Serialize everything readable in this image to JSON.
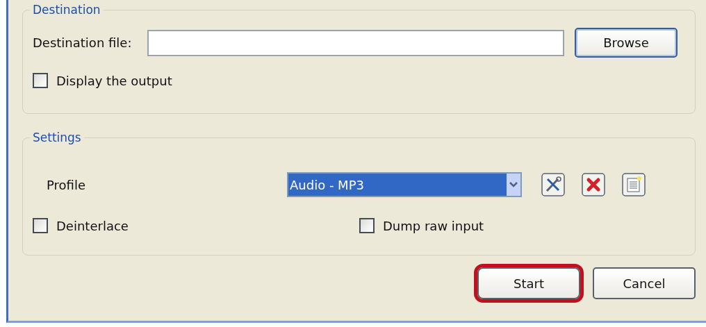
{
  "destination": {
    "title": "Destination",
    "file_label": "Destination file:",
    "browse": "Browse",
    "display_output": {
      "label": "Display the output",
      "checked": false
    }
  },
  "settings": {
    "title": "Settings",
    "profile_label": "Profile",
    "profile": {
      "value": "Audio - MP3",
      "focused": true
    },
    "tool_buttons": [
      {
        "kind": "edit"
      },
      {
        "kind": "delete"
      },
      {
        "kind": "new"
      }
    ],
    "options": [
      {
        "label": "Deinterlace",
        "checked": false
      },
      {
        "label": "Dump raw input",
        "checked": false
      }
    ]
  },
  "buttons": [
    {
      "label": "Start",
      "highlighted": true
    },
    {
      "label": "Cancel",
      "highlighted": false
    }
  ]
}
